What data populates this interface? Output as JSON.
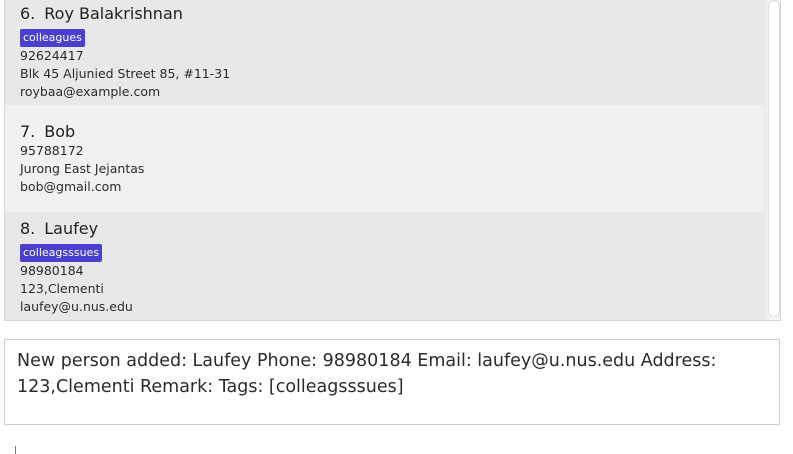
{
  "people": [
    {
      "index": "6.",
      "name": "Roy Balakrishnan",
      "tags": [
        "colleagues"
      ],
      "phone": "92624417",
      "address": "Blk 45 Aljunied Street 85, #11-31",
      "email": "roybaa@example.com"
    },
    {
      "index": "7.",
      "name": "Bob",
      "tags": [],
      "phone": "95788172",
      "address": "Jurong East Jejantas",
      "email": "bob@gmail.com"
    },
    {
      "index": "8.",
      "name": "Laufey",
      "tags": [
        "colleagsssues"
      ],
      "phone": "98980184",
      "address": "123,Clementi",
      "email": "laufey@u.nus.edu"
    }
  ],
  "result": {
    "text": "New person added: Laufey Phone: 98980184 Email: laufey@u.nus.edu Address: 123,Clementi Remark:  Tags: [colleagsssues]"
  },
  "colors": {
    "tag": "#4a3fcf",
    "card_odd": "#e8e8e8",
    "card_even": "#f1f1f1"
  }
}
